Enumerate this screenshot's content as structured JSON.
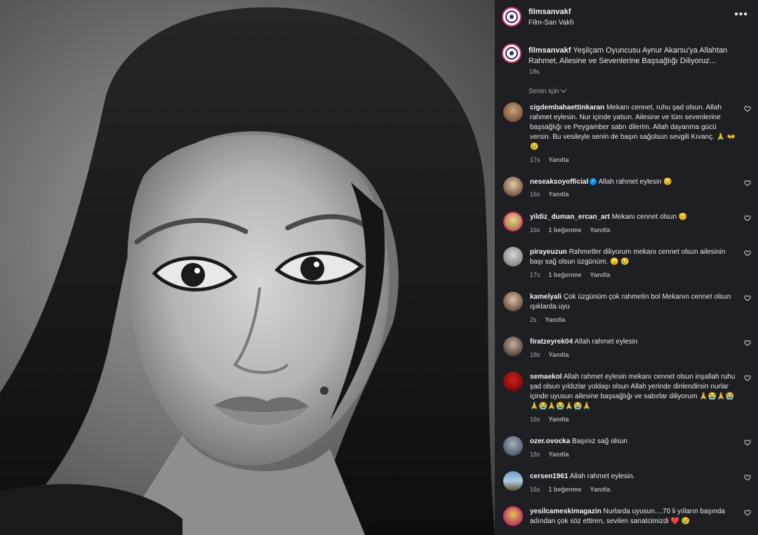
{
  "header": {
    "username": "filmsanvakf",
    "subtitle": "Film-San Vakfı",
    "more_label": "•••"
  },
  "caption": {
    "username": "filmsanvakf",
    "text": "Yeşilçam Oyuncusu Aynur Akarsu'ya Allahtan Rahmet, Ailesine ve Sevenlerine Başsağlığı Diliyoruz...",
    "time": "18s"
  },
  "filter": {
    "label": "Senin için"
  },
  "comments": [
    {
      "username": "cigdembahaettinkaran",
      "text": "Mekanı cennet, ruhu şad olsun. Allah rahmet eylesin. Nur içinde yatsın. Ailesine ve tüm sevenlerine başsağlığı ve Peygamber sabrı dilerim. Allah dayanma gücü versin. Bu vesileyle senin de başın sağolsun sevgili Kıvanç. 🙏 👐 😢",
      "time": "17s",
      "likes": "",
      "reply": "Yanıtla"
    },
    {
      "username": "neseaksoyofficial",
      "verified": "✓",
      "text": "Allah rahmet eylesin 😔",
      "time": "16s",
      "likes": "",
      "reply": "Yanıtla"
    },
    {
      "username": "yildiz_duman_ercan_art",
      "text": "Mekanı cennet olsun 😔",
      "time": "16s",
      "likes": "1 beğenme",
      "reply": "Yanıtla"
    },
    {
      "username": "pirayeuzun",
      "text": "Rahmetler diliyorum mekanı cennet olsun ailesinin başı sağ olsun üzgünüm. 😞 😥",
      "time": "17s",
      "likes": "1 beğenme",
      "reply": "Yanıtla"
    },
    {
      "username": "kamelyali",
      "text": "Çok üzgünüm çok rahmetin bol Mekanın cennet olsun ışıklarda uyu",
      "time": "2s",
      "likes": "",
      "reply": "Yanıtla"
    },
    {
      "username": "firatzeyrek04",
      "text": "Allah rahmet eylesin",
      "time": "18s",
      "likes": "",
      "reply": "Yanıtla"
    },
    {
      "username": "semaekol",
      "text": "Allah rahmet eylesin mekanı cennet olsun inşallah ruhu şad olsun yıldızlar yoldaşı olsun Allah yerinde dinlendirsin nurlar içinde uyusun ailesine başsağlığı ve sabırlar diliyorum 🙏😭🙏😭🙏😭🙏😭🙏😭🙏",
      "time": "16s",
      "likes": "",
      "reply": "Yanıtla"
    },
    {
      "username": "ozer.ovocka",
      "text": "Başınız sağ olsun",
      "time": "18s",
      "likes": "",
      "reply": "Yanıtla"
    },
    {
      "username": "cersen1961",
      "text": "Allah rahmet eylesin.",
      "time": "16s",
      "likes": "1 beğenme",
      "reply": "Yanıtla"
    },
    {
      "username": "yesilcameskimagazin",
      "text": "Nurlarda uyusun....70 li yılların başında adından çok söz ettiren, sevilen sanatcimizdi ❤️ 😢",
      "time": "",
      "likes": "",
      "reply": ""
    }
  ],
  "colors": {
    "panel_bg": "#1e1f22",
    "story_ring": "#e1306c",
    "verified": "#0095f6",
    "muted_text": "#a8a8a8"
  },
  "icons": [
    "more-options-icon",
    "chevron-down-icon",
    "heart-icon",
    "verified-badge-icon"
  ]
}
